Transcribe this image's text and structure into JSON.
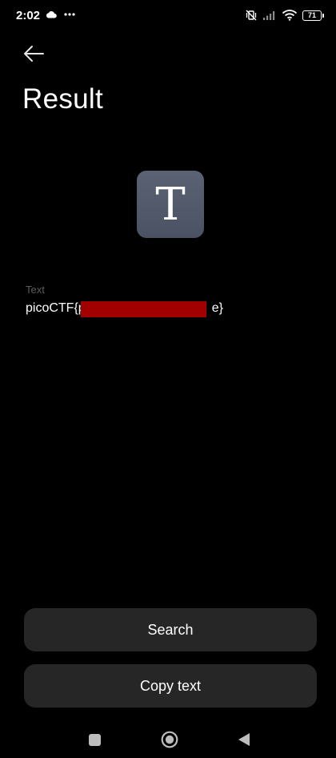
{
  "status_bar": {
    "time": "2:02",
    "battery_level": "71",
    "icons": [
      "cloud-icon",
      "more-dots-icon",
      "vibrate-off-icon",
      "signal-icon",
      "wifi-icon",
      "battery-icon"
    ]
  },
  "header": {
    "back_icon": "arrow-left-icon",
    "title": "Result"
  },
  "result": {
    "type_icon_letter": "T",
    "field_label": "Text",
    "value_prefix": "picoCTF{p",
    "value_suffix": "e}",
    "redaction_color": "#a00000"
  },
  "actions": {
    "search_label": "Search",
    "copy_label": "Copy text"
  },
  "nav_bar": {
    "icons": [
      "recents-square-icon",
      "home-circle-icon",
      "back-triangle-icon"
    ]
  },
  "colors": {
    "background": "#000000",
    "button_background": "#262626",
    "icon_tile": "#525a6b",
    "label_gray": "#5c5c5c"
  }
}
